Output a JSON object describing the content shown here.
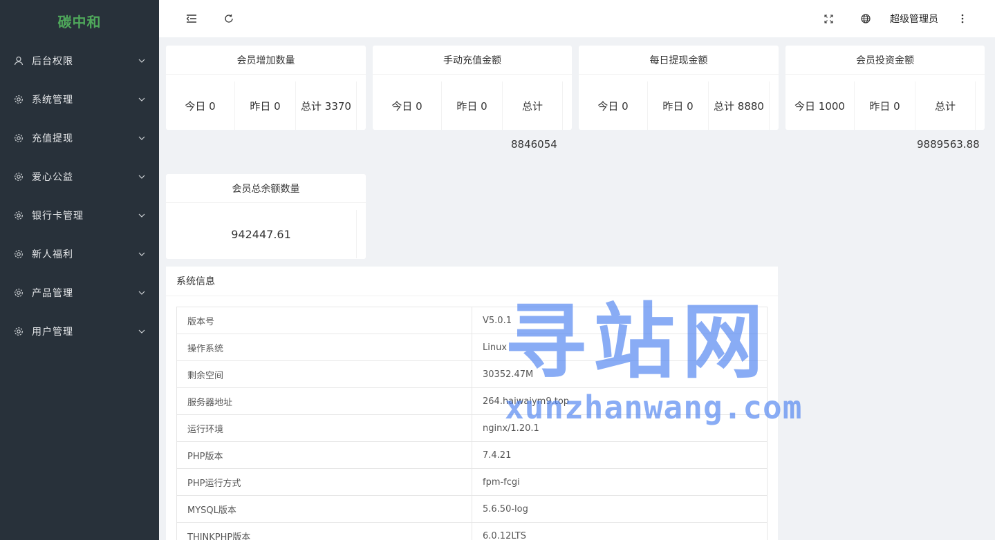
{
  "app": {
    "title": "碳中和"
  },
  "sidebar": {
    "items": [
      {
        "label": "后台权限",
        "icon": "user-icon"
      },
      {
        "label": "系统管理",
        "icon": "gear-icon"
      },
      {
        "label": "充值提现",
        "icon": "gear-icon"
      },
      {
        "label": "爱心公益",
        "icon": "gear-icon"
      },
      {
        "label": "银行卡管理",
        "icon": "gear-icon"
      },
      {
        "label": "新人福利",
        "icon": "gear-icon"
      },
      {
        "label": "产品管理",
        "icon": "gear-icon"
      },
      {
        "label": "用户管理",
        "icon": "gear-icon"
      }
    ]
  },
  "header": {
    "admin_name": "超级管理员",
    "icons": [
      "menu-fold-icon",
      "refresh-icon",
      "fullscreen-icon",
      "globe-icon",
      "more-vertical-icon"
    ]
  },
  "cards": [
    {
      "title": "会员增加数量",
      "today": "今日 0",
      "yesterday": "昨日 0",
      "total": "总计 3370",
      "overflow": ""
    },
    {
      "title": "手动充值金额",
      "today": "今日 0",
      "yesterday": "昨日 0",
      "total": "总计",
      "overflow": "8846054"
    },
    {
      "title": "每日提现金额",
      "today": "今日 0",
      "yesterday": "昨日 0",
      "total": "总计 8880",
      "overflow": ""
    },
    {
      "title": "会员投资金额",
      "today": "今日 1000",
      "yesterday": "昨日 0",
      "total": "总计",
      "overflow": "9889563.88"
    }
  ],
  "balance_card": {
    "title": "会员总余额数量",
    "value": "942447.61"
  },
  "system_info": {
    "title": "系统信息",
    "rows": [
      {
        "key": "版本号",
        "value": "V5.0.1"
      },
      {
        "key": "操作系统",
        "value": "Linux"
      },
      {
        "key": "剩余空间",
        "value": "30352.47M"
      },
      {
        "key": "服务器地址",
        "value": "264.haiwaiym9.top"
      },
      {
        "key": "运行环境",
        "value": "nginx/1.20.1"
      },
      {
        "key": "PHP版本",
        "value": "7.4.21"
      },
      {
        "key": "PHP运行方式",
        "value": "fpm-fcgi"
      },
      {
        "key": "MYSQL版本",
        "value": "5.6.50-log"
      },
      {
        "key": "THINKPHP版本",
        "value": "6.0.12LTS"
      }
    ]
  },
  "watermark": {
    "cn": "寻站网",
    "en": "xunzhanwang.com"
  },
  "colors": {
    "sidebar_bg": "#28313a",
    "logo": "#4fa85b",
    "page_bg": "#f0f2f5",
    "watermark": "#4a80f0"
  }
}
